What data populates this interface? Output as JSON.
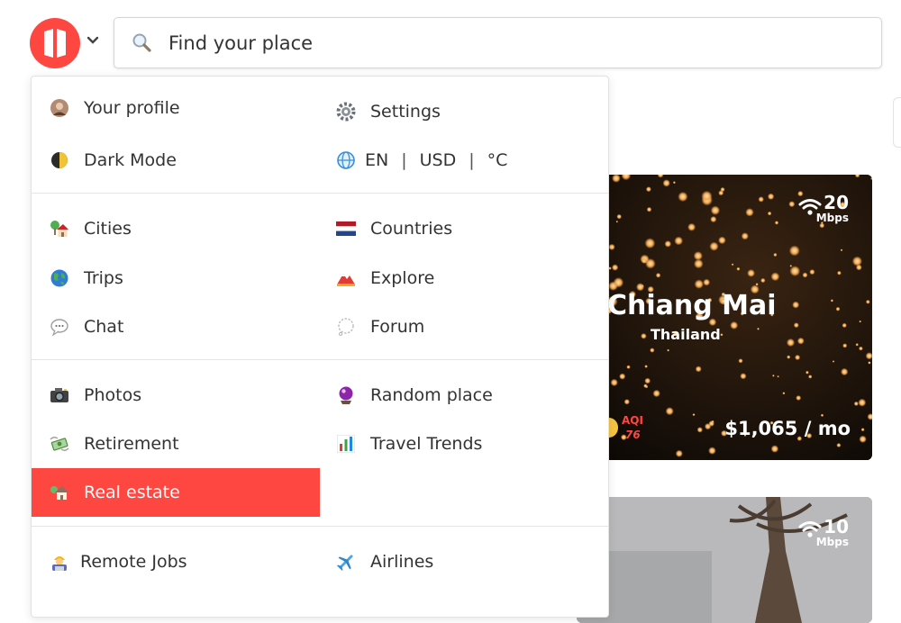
{
  "header": {
    "search": {
      "placeholder": "Find your place"
    }
  },
  "menu": {
    "group1": {
      "left": [
        {
          "label": "Your profile",
          "icon": "avatar-icon"
        },
        {
          "label": "Dark Mode",
          "icon": "half-moon-icon"
        }
      ],
      "right": [
        {
          "label": "Settings",
          "icon": "gear-icon"
        },
        {
          "icon": "globe-icon",
          "language": "EN",
          "currency": "USD",
          "unit": "°C",
          "separator": "|"
        }
      ]
    },
    "group2": {
      "left": [
        {
          "label": "Cities",
          "icon": "house-tree-icon"
        },
        {
          "label": "Trips",
          "icon": "globe-earth-icon"
        },
        {
          "label": "Chat",
          "icon": "speech-bubble-icon"
        }
      ],
      "right": [
        {
          "label": "Countries",
          "icon": "flag-netherlands-icon"
        },
        {
          "label": "Explore",
          "icon": "mountain-icon"
        },
        {
          "label": "Forum",
          "icon": "thought-bubble-icon"
        }
      ]
    },
    "group3": {
      "left": [
        {
          "label": "Photos",
          "icon": "camera-icon"
        },
        {
          "label": "Retirement",
          "icon": "money-wings-icon"
        },
        {
          "label": "Real estate",
          "icon": "house-icon",
          "active": true
        }
      ],
      "right": [
        {
          "label": "Random place",
          "icon": "crystal-ball-icon"
        },
        {
          "label": "Travel Trends",
          "icon": "bar-chart-icon"
        }
      ]
    },
    "group4": {
      "left": [
        {
          "label": "Remote Jobs",
          "icon": "worker-icon"
        }
      ],
      "right": [
        {
          "label": "Airlines",
          "icon": "airplane-icon"
        }
      ]
    }
  },
  "cards": [
    {
      "city": "Chiang Mai",
      "country": "Thailand",
      "internet_speed": "20",
      "speed_unit": "Mbps",
      "aqi_label": "AQI",
      "aqi_value": "76",
      "cost": "$1,065 / mo"
    },
    {
      "internet_speed": "10",
      "speed_unit": "Mbps"
    }
  ],
  "colors": {
    "brand": "#ff4742",
    "active_item_bg": "#ff4742",
    "aqi_text": "#ff4742"
  }
}
